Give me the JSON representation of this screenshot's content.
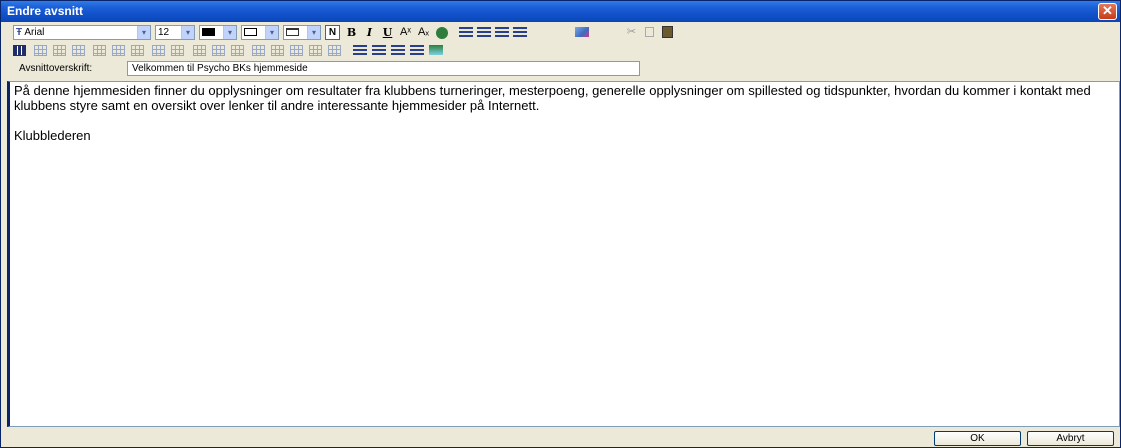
{
  "window": {
    "title": "Endre avsnitt",
    "close_glyph": "✕"
  },
  "toolbar": {
    "font_name": "Arial",
    "font_size": "12",
    "bold_glyph": "B",
    "italic_glyph": "I",
    "underline_glyph": "U",
    "normal_glyph": "N",
    "superscript_glyph": "Aˣ",
    "subscript_glyph": "Aₓ",
    "dropdown_glyph": "▾",
    "cut_glyph": "✂"
  },
  "section": {
    "heading_label": "Avsnittoverskrift:",
    "heading_value": "Velkommen til Psycho BKs hjemmeside"
  },
  "editor": {
    "paragraph_1": "På denne hjemmesiden finner du opplysninger om resultater fra klubbens turneringer, mesterpoeng, generelle opplysninger om spillested og tidspunkter, hvordan du kommer i kontakt med klubbens styre samt en oversikt over lenker til andre interessante hjemmesider på Internett.",
    "paragraph_2": "Klubblederen"
  },
  "buttons": {
    "ok": "OK",
    "cancel": "Avbryt"
  },
  "colors": {
    "titlebar": "#0f4fc8",
    "dialog_bg": "#ece9d8",
    "border": "#7f9db9"
  }
}
